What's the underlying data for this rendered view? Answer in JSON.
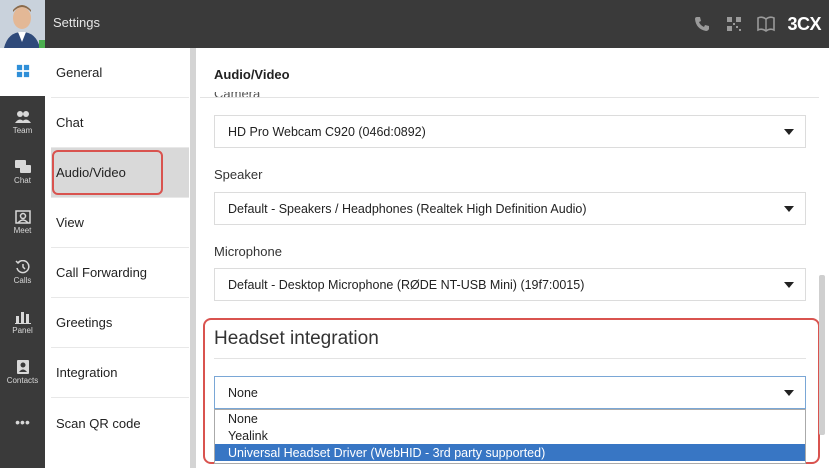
{
  "header": {
    "title": "Settings",
    "brand": "3CX",
    "icons": [
      "phone-icon",
      "qr-code-icon",
      "book-icon"
    ]
  },
  "rail": {
    "items": [
      {
        "label": "",
        "icon": "windows-icon"
      },
      {
        "label": "Team",
        "icon": "team-icon"
      },
      {
        "label": "Chat",
        "icon": "chat-icon"
      },
      {
        "label": "Meet",
        "icon": "meet-icon"
      },
      {
        "label": "Calls",
        "icon": "calls-icon"
      },
      {
        "label": "Panel",
        "icon": "panel-icon"
      },
      {
        "label": "Contacts",
        "icon": "contacts-icon"
      },
      {
        "label": "•••",
        "icon": "more-icon"
      }
    ]
  },
  "menu": {
    "items": [
      {
        "label": "General"
      },
      {
        "label": "Chat"
      },
      {
        "label": "Audio/Video",
        "active": true
      },
      {
        "label": "View"
      },
      {
        "label": "Call Forwarding"
      },
      {
        "label": "Greetings"
      },
      {
        "label": "Integration"
      },
      {
        "label": "Scan QR code"
      }
    ]
  },
  "content": {
    "section_title": "Audio/Video",
    "camera": {
      "label": "Camera",
      "value": "HD Pro Webcam C920 (046d:0892)"
    },
    "speaker": {
      "label": "Speaker",
      "value": "Default - Speakers / Headphones (Realtek High Definition Audio)"
    },
    "microphone": {
      "label": "Microphone",
      "value": "Default - Desktop Microphone (RØDE NT-USB Mini) (19f7:0015)"
    },
    "headset": {
      "title": "Headset integration",
      "value": "None",
      "options": [
        "None",
        "Yealink",
        "Universal Headset Driver (WebHID - 3rd party supported)"
      ],
      "highlighted_option": 2
    }
  },
  "colors": {
    "dark_bar": "#3a3a3a",
    "highlight_red": "#d9534f",
    "selection_blue": "#3876c4"
  }
}
